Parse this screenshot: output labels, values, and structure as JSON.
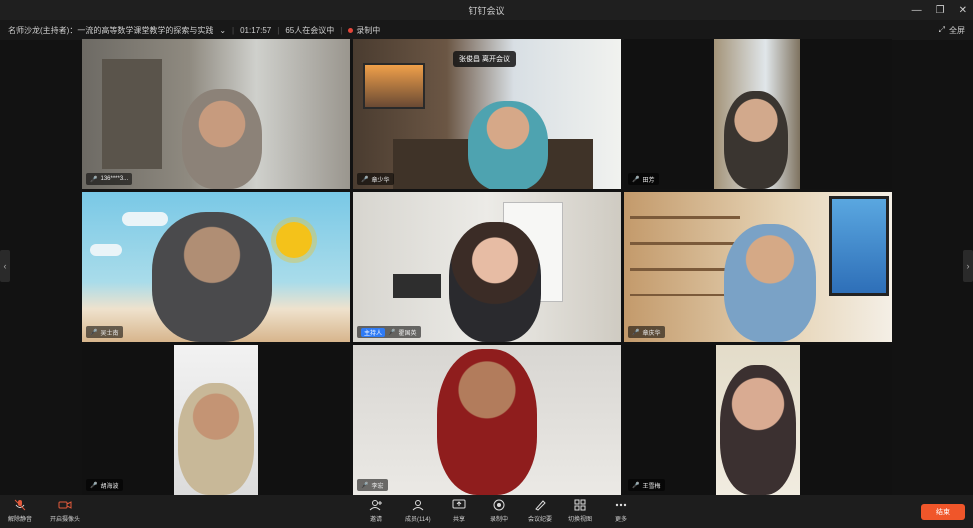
{
  "window": {
    "title": "钉钉会议",
    "controls": [
      "minimize-icon",
      "restore-icon",
      "close-icon"
    ]
  },
  "info": {
    "meeting_title": "名师沙龙(主持者)：一流的高等数学课堂教学的探索与实践",
    "elapsed": "01:17:57",
    "participants_status": "65人在会议中",
    "recording": "录制中",
    "fullscreen_label": "全屏"
  },
  "tooltip": "张俊昌 离开会议",
  "tiles": [
    {
      "name": "136****3...",
      "muted": false,
      "host": false
    },
    {
      "name": "章少华",
      "muted": false,
      "host": false
    },
    {
      "name": "田芳",
      "muted": false,
      "host": false
    },
    {
      "name": "吴士南",
      "muted": false,
      "host": false
    },
    {
      "name": "霍国英",
      "muted": false,
      "host": true,
      "host_label": "主持人"
    },
    {
      "name": "章庆华",
      "muted": false,
      "host": false
    },
    {
      "name": "胡海波",
      "muted": false,
      "host": false
    },
    {
      "name": "李宏",
      "muted": false,
      "host": false
    },
    {
      "name": "王雪梅",
      "muted": false,
      "host": false
    }
  ],
  "toolbar": {
    "mic": "解除静音",
    "camera": "开启摄像头",
    "invite": "邀请",
    "members": "成员(114)",
    "share": "共享",
    "record": "录制中",
    "minutes": "会议纪要",
    "layout": "切换视图",
    "more": "更多",
    "end": "结束"
  },
  "colors": {
    "accent": "#2f7bf5",
    "end_button": "#f0562a",
    "recording": "#e5463a"
  }
}
